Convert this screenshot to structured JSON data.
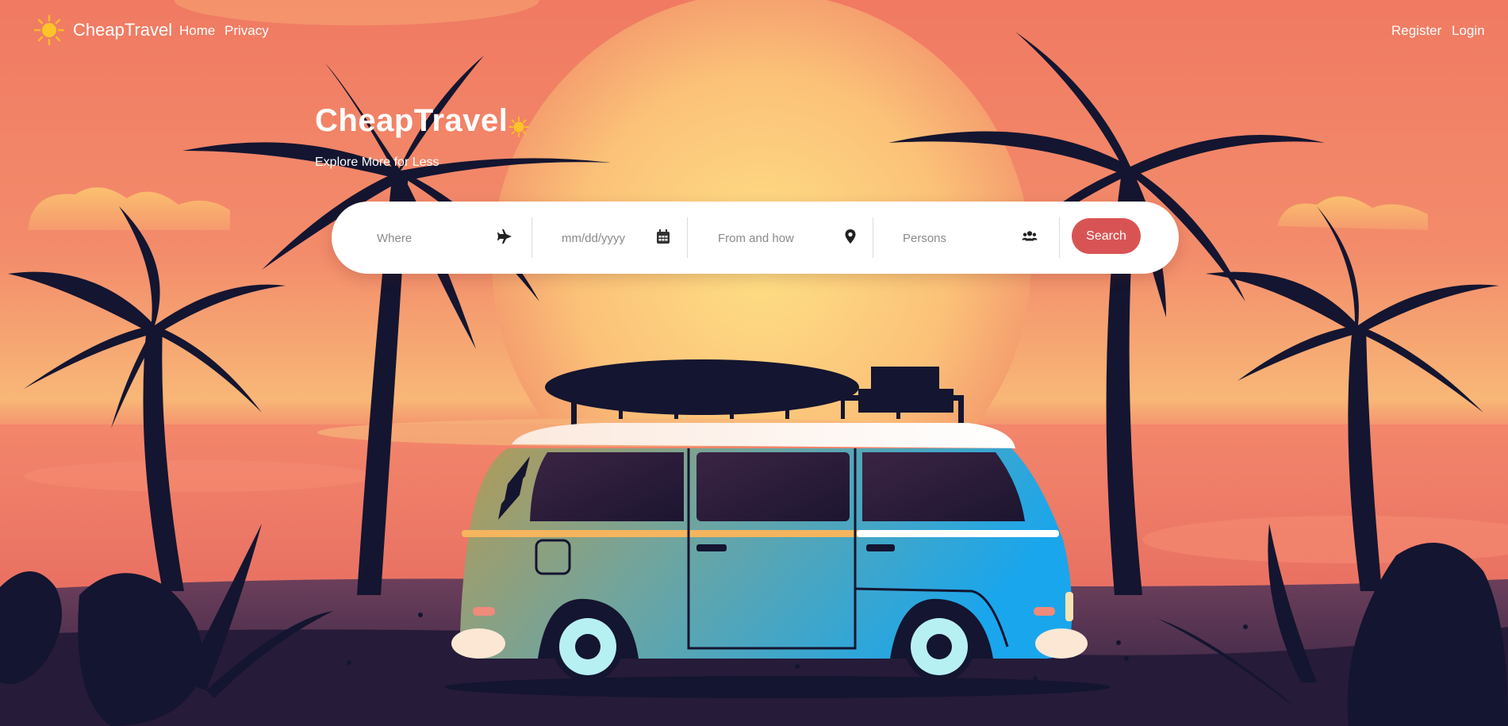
{
  "brand": {
    "name": "CheapTravel",
    "logo_icon": "sun-icon"
  },
  "nav": {
    "left": [
      {
        "label": "Home"
      },
      {
        "label": "Privacy"
      }
    ],
    "right": [
      {
        "label": "Register"
      },
      {
        "label": "Login"
      }
    ]
  },
  "hero": {
    "title": "CheapTravel",
    "title_icon": "sun-icon",
    "subtitle": "Explore More for Less"
  },
  "search": {
    "fields": [
      {
        "placeholder": "Where",
        "value": "",
        "icon": "plane-icon"
      },
      {
        "placeholder": "mm/dd/yyyy",
        "value": "",
        "icon": "calendar-icon"
      },
      {
        "placeholder": "From and how",
        "value": "",
        "icon": "map-marker-icon"
      },
      {
        "placeholder": "Persons",
        "value": "",
        "icon": "users-icon"
      }
    ],
    "button_label": "Search"
  },
  "colors": {
    "accent": "#d85454",
    "sky_top": "#f07a62",
    "sun": "#fdd77c",
    "silhouette": "#141530",
    "van_blue": "#2aa8e6",
    "van_yellow": "#b29c58"
  }
}
